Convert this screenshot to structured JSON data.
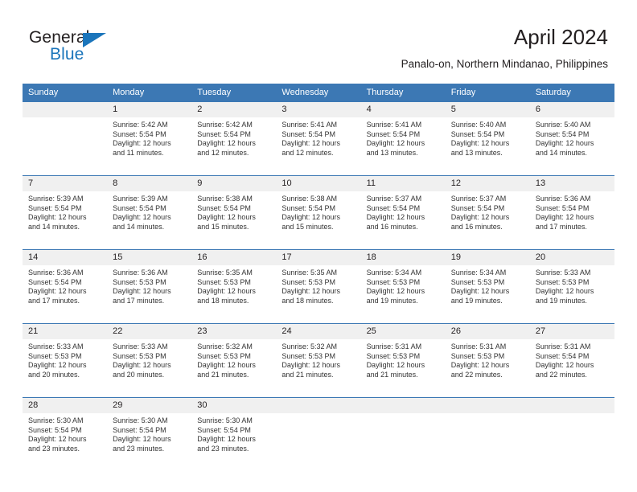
{
  "brand": {
    "name_top": "General",
    "name_bottom": "Blue",
    "triangle_color": "#1b75bb",
    "text_color": "#231f20"
  },
  "header": {
    "title": "April 2024",
    "subtitle": "Panalo-on, Northern Mindanao, Philippines"
  },
  "colors": {
    "header_blue": "#3c78b4",
    "daynum_band": "#f0f0f0",
    "cell_text": "#333333",
    "separator": "#3c78b4"
  },
  "calendar": {
    "weekday_headers": [
      "Sunday",
      "Monday",
      "Tuesday",
      "Wednesday",
      "Thursday",
      "Friday",
      "Saturday"
    ],
    "weeks": [
      {
        "days": [
          {
            "num": "",
            "sunrise": "",
            "sunset": "",
            "daylight_1": "",
            "daylight_2": ""
          },
          {
            "num": "1",
            "sunrise": "Sunrise: 5:42 AM",
            "sunset": "Sunset: 5:54 PM",
            "daylight_1": "Daylight: 12 hours",
            "daylight_2": "and 11 minutes."
          },
          {
            "num": "2",
            "sunrise": "Sunrise: 5:42 AM",
            "sunset": "Sunset: 5:54 PM",
            "daylight_1": "Daylight: 12 hours",
            "daylight_2": "and 12 minutes."
          },
          {
            "num": "3",
            "sunrise": "Sunrise: 5:41 AM",
            "sunset": "Sunset: 5:54 PM",
            "daylight_1": "Daylight: 12 hours",
            "daylight_2": "and 12 minutes."
          },
          {
            "num": "4",
            "sunrise": "Sunrise: 5:41 AM",
            "sunset": "Sunset: 5:54 PM",
            "daylight_1": "Daylight: 12 hours",
            "daylight_2": "and 13 minutes."
          },
          {
            "num": "5",
            "sunrise": "Sunrise: 5:40 AM",
            "sunset": "Sunset: 5:54 PM",
            "daylight_1": "Daylight: 12 hours",
            "daylight_2": "and 13 minutes."
          },
          {
            "num": "6",
            "sunrise": "Sunrise: 5:40 AM",
            "sunset": "Sunset: 5:54 PM",
            "daylight_1": "Daylight: 12 hours",
            "daylight_2": "and 14 minutes."
          }
        ]
      },
      {
        "days": [
          {
            "num": "7",
            "sunrise": "Sunrise: 5:39 AM",
            "sunset": "Sunset: 5:54 PM",
            "daylight_1": "Daylight: 12 hours",
            "daylight_2": "and 14 minutes."
          },
          {
            "num": "8",
            "sunrise": "Sunrise: 5:39 AM",
            "sunset": "Sunset: 5:54 PM",
            "daylight_1": "Daylight: 12 hours",
            "daylight_2": "and 14 minutes."
          },
          {
            "num": "9",
            "sunrise": "Sunrise: 5:38 AM",
            "sunset": "Sunset: 5:54 PM",
            "daylight_1": "Daylight: 12 hours",
            "daylight_2": "and 15 minutes."
          },
          {
            "num": "10",
            "sunrise": "Sunrise: 5:38 AM",
            "sunset": "Sunset: 5:54 PM",
            "daylight_1": "Daylight: 12 hours",
            "daylight_2": "and 15 minutes."
          },
          {
            "num": "11",
            "sunrise": "Sunrise: 5:37 AM",
            "sunset": "Sunset: 5:54 PM",
            "daylight_1": "Daylight: 12 hours",
            "daylight_2": "and 16 minutes."
          },
          {
            "num": "12",
            "sunrise": "Sunrise: 5:37 AM",
            "sunset": "Sunset: 5:54 PM",
            "daylight_1": "Daylight: 12 hours",
            "daylight_2": "and 16 minutes."
          },
          {
            "num": "13",
            "sunrise": "Sunrise: 5:36 AM",
            "sunset": "Sunset: 5:54 PM",
            "daylight_1": "Daylight: 12 hours",
            "daylight_2": "and 17 minutes."
          }
        ]
      },
      {
        "days": [
          {
            "num": "14",
            "sunrise": "Sunrise: 5:36 AM",
            "sunset": "Sunset: 5:54 PM",
            "daylight_1": "Daylight: 12 hours",
            "daylight_2": "and 17 minutes."
          },
          {
            "num": "15",
            "sunrise": "Sunrise: 5:36 AM",
            "sunset": "Sunset: 5:53 PM",
            "daylight_1": "Daylight: 12 hours",
            "daylight_2": "and 17 minutes."
          },
          {
            "num": "16",
            "sunrise": "Sunrise: 5:35 AM",
            "sunset": "Sunset: 5:53 PM",
            "daylight_1": "Daylight: 12 hours",
            "daylight_2": "and 18 minutes."
          },
          {
            "num": "17",
            "sunrise": "Sunrise: 5:35 AM",
            "sunset": "Sunset: 5:53 PM",
            "daylight_1": "Daylight: 12 hours",
            "daylight_2": "and 18 minutes."
          },
          {
            "num": "18",
            "sunrise": "Sunrise: 5:34 AM",
            "sunset": "Sunset: 5:53 PM",
            "daylight_1": "Daylight: 12 hours",
            "daylight_2": "and 19 minutes."
          },
          {
            "num": "19",
            "sunrise": "Sunrise: 5:34 AM",
            "sunset": "Sunset: 5:53 PM",
            "daylight_1": "Daylight: 12 hours",
            "daylight_2": "and 19 minutes."
          },
          {
            "num": "20",
            "sunrise": "Sunrise: 5:33 AM",
            "sunset": "Sunset: 5:53 PM",
            "daylight_1": "Daylight: 12 hours",
            "daylight_2": "and 19 minutes."
          }
        ]
      },
      {
        "days": [
          {
            "num": "21",
            "sunrise": "Sunrise: 5:33 AM",
            "sunset": "Sunset: 5:53 PM",
            "daylight_1": "Daylight: 12 hours",
            "daylight_2": "and 20 minutes."
          },
          {
            "num": "22",
            "sunrise": "Sunrise: 5:33 AM",
            "sunset": "Sunset: 5:53 PM",
            "daylight_1": "Daylight: 12 hours",
            "daylight_2": "and 20 minutes."
          },
          {
            "num": "23",
            "sunrise": "Sunrise: 5:32 AM",
            "sunset": "Sunset: 5:53 PM",
            "daylight_1": "Daylight: 12 hours",
            "daylight_2": "and 21 minutes."
          },
          {
            "num": "24",
            "sunrise": "Sunrise: 5:32 AM",
            "sunset": "Sunset: 5:53 PM",
            "daylight_1": "Daylight: 12 hours",
            "daylight_2": "and 21 minutes."
          },
          {
            "num": "25",
            "sunrise": "Sunrise: 5:31 AM",
            "sunset": "Sunset: 5:53 PM",
            "daylight_1": "Daylight: 12 hours",
            "daylight_2": "and 21 minutes."
          },
          {
            "num": "26",
            "sunrise": "Sunrise: 5:31 AM",
            "sunset": "Sunset: 5:53 PM",
            "daylight_1": "Daylight: 12 hours",
            "daylight_2": "and 22 minutes."
          },
          {
            "num": "27",
            "sunrise": "Sunrise: 5:31 AM",
            "sunset": "Sunset: 5:54 PM",
            "daylight_1": "Daylight: 12 hours",
            "daylight_2": "and 22 minutes."
          }
        ]
      },
      {
        "days": [
          {
            "num": "28",
            "sunrise": "Sunrise: 5:30 AM",
            "sunset": "Sunset: 5:54 PM",
            "daylight_1": "Daylight: 12 hours",
            "daylight_2": "and 23 minutes."
          },
          {
            "num": "29",
            "sunrise": "Sunrise: 5:30 AM",
            "sunset": "Sunset: 5:54 PM",
            "daylight_1": "Daylight: 12 hours",
            "daylight_2": "and 23 minutes."
          },
          {
            "num": "30",
            "sunrise": "Sunrise: 5:30 AM",
            "sunset": "Sunset: 5:54 PM",
            "daylight_1": "Daylight: 12 hours",
            "daylight_2": "and 23 minutes."
          },
          {
            "num": "",
            "sunrise": "",
            "sunset": "",
            "daylight_1": "",
            "daylight_2": ""
          },
          {
            "num": "",
            "sunrise": "",
            "sunset": "",
            "daylight_1": "",
            "daylight_2": ""
          },
          {
            "num": "",
            "sunrise": "",
            "sunset": "",
            "daylight_1": "",
            "daylight_2": ""
          },
          {
            "num": "",
            "sunrise": "",
            "sunset": "",
            "daylight_1": "",
            "daylight_2": ""
          }
        ]
      }
    ]
  }
}
